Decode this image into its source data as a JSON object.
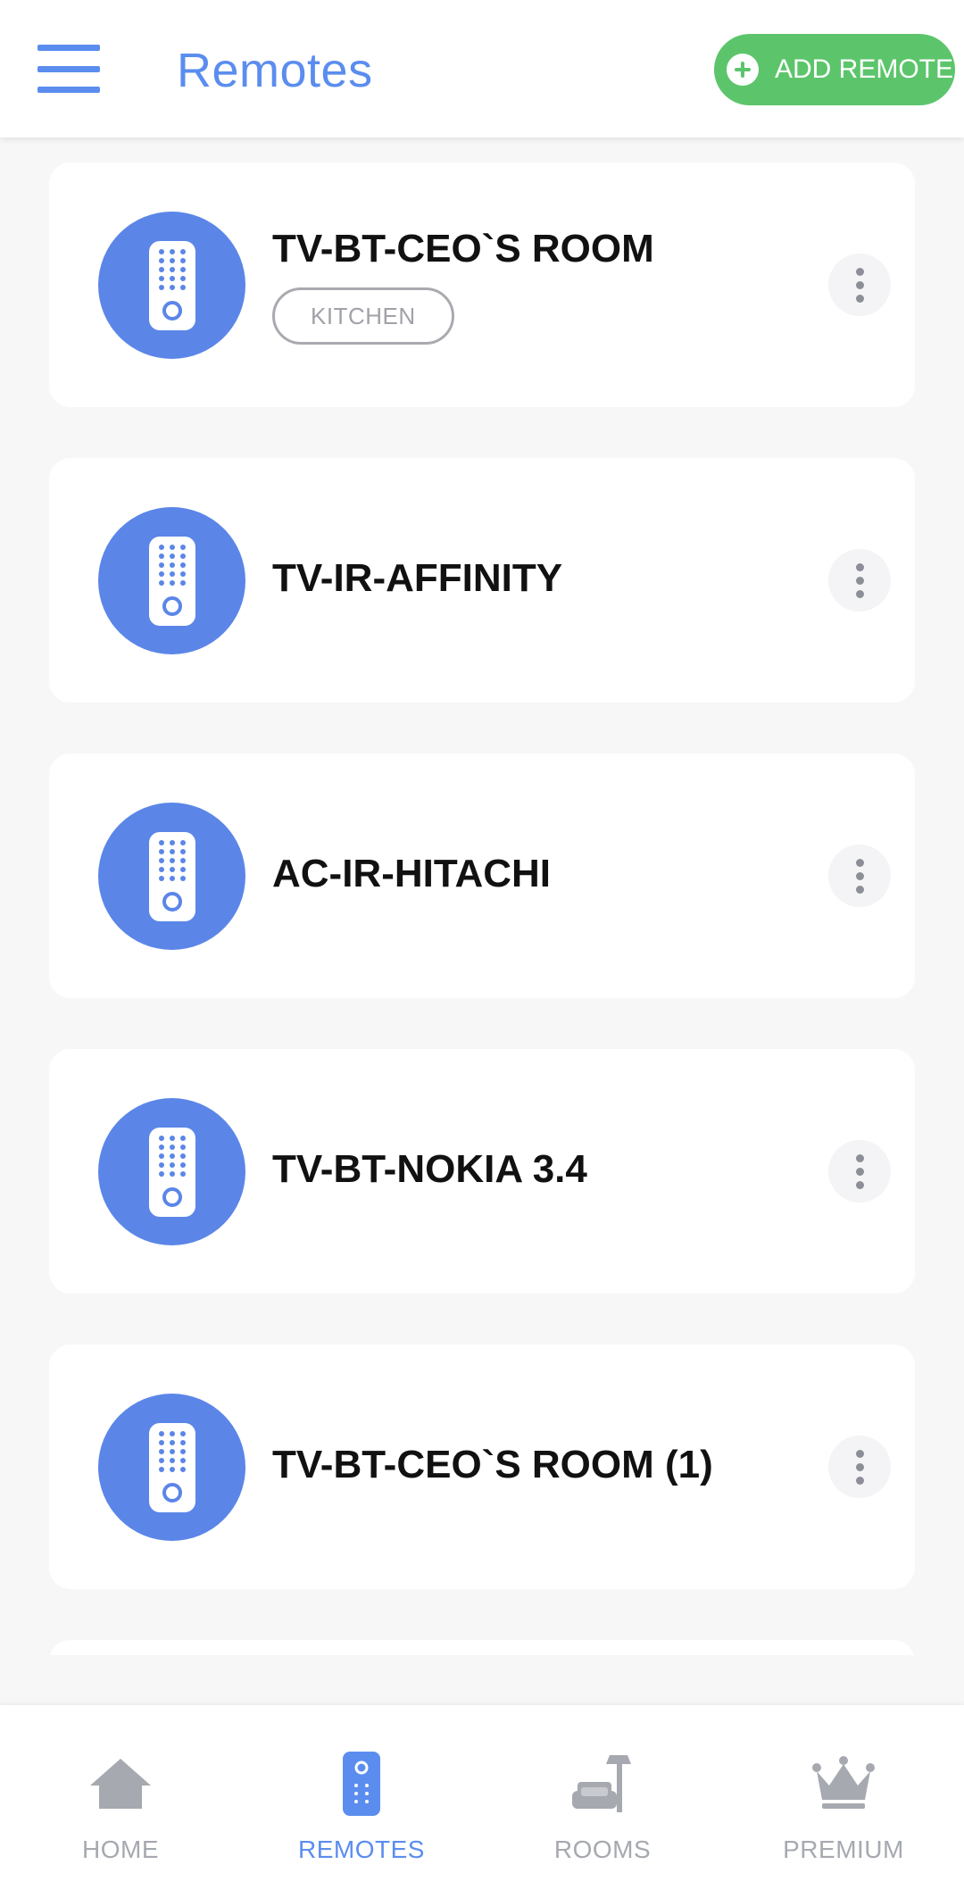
{
  "header": {
    "title": "Remotes",
    "add_button_label": "ADD REMOTE"
  },
  "remotes": [
    {
      "name": "TV-BT-CEO`S ROOM",
      "tag": "KITCHEN"
    },
    {
      "name": "TV-IR-AFFINITY"
    },
    {
      "name": "AC-IR-HITACHI"
    },
    {
      "name": "TV-BT-NOKIA 3.4"
    },
    {
      "name": "TV-BT-CEO`S ROOM (1)"
    }
  ],
  "bottom_nav": [
    {
      "label": "HOME",
      "icon": "home-icon",
      "active": false
    },
    {
      "label": "REMOTES",
      "icon": "remote-icon",
      "active": true
    },
    {
      "label": "ROOMS",
      "icon": "sofa-icon",
      "active": false
    },
    {
      "label": "PREMIUM",
      "icon": "crown-icon",
      "active": false
    }
  ],
  "colors": {
    "accent": "#5b8def",
    "avatar": "#5b86e8",
    "add_button": "#5cc56b",
    "inactive": "#a6a9b0"
  }
}
